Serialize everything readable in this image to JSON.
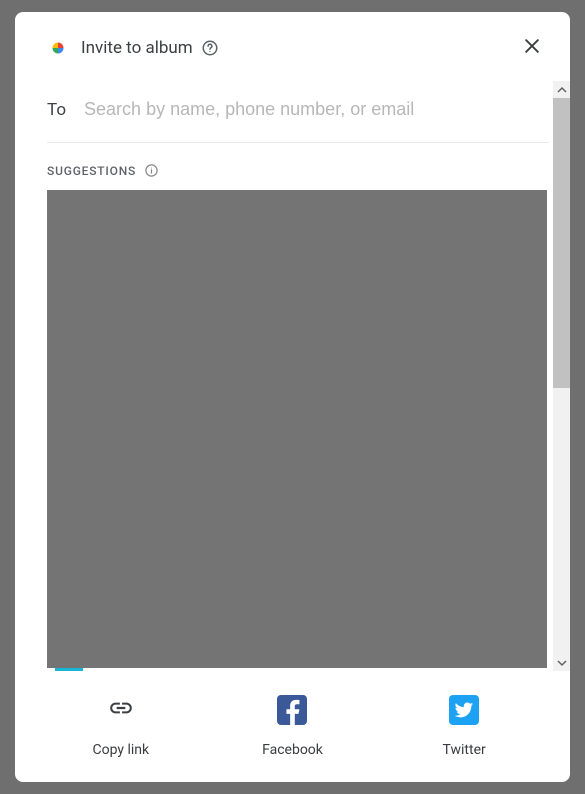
{
  "header": {
    "title": "Invite to album"
  },
  "to": {
    "label": "To",
    "placeholder": "Search by name, phone number, or email"
  },
  "suggestions": {
    "label": "SUGGESTIONS"
  },
  "share": {
    "copy_link": "Copy link",
    "facebook": "Facebook",
    "twitter": "Twitter"
  }
}
